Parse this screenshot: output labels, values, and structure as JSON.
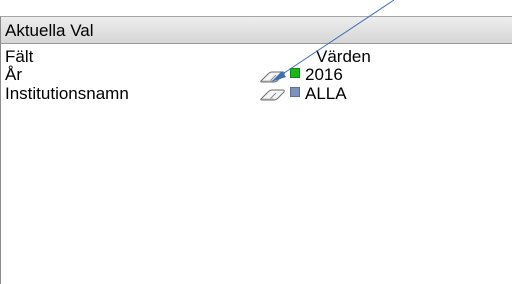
{
  "panel": {
    "title": "Aktuella Val",
    "header": {
      "field": "Fält",
      "values": "Värden"
    },
    "rows": [
      {
        "field": "År",
        "value": "2016",
        "state_color": "#18b818",
        "state": "selected"
      },
      {
        "field": "Institutionsnamn",
        "value": "ALLA",
        "state_color": "#7f92bb",
        "state": "locked"
      }
    ]
  },
  "annotation": {
    "type": "arrow",
    "color": "#3f6fb2",
    "points_to": "clear-selection-icon"
  },
  "icons": {
    "clear_selection": "eraser-icon"
  }
}
